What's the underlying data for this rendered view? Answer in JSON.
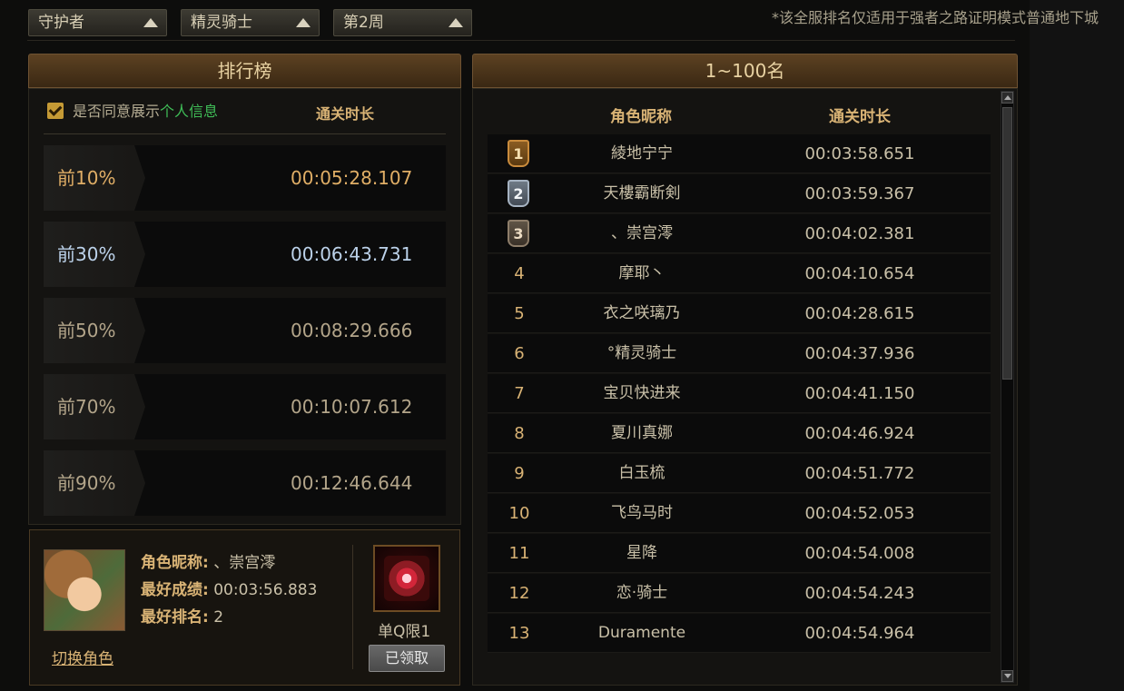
{
  "filters": [
    {
      "label": "守护者"
    },
    {
      "label": "精灵骑士"
    },
    {
      "label": "第2周"
    }
  ],
  "notice": "*该全服排名仅适用于强者之路证明模式普通地下城",
  "left_panel": {
    "title": "排行榜",
    "agree_prefix": "是否同意展示",
    "agree_link": "个人信息",
    "column_header": "通关时长",
    "tiers": [
      {
        "label": "前10%",
        "time": "00:05:28.107",
        "color": "#e0ae66"
      },
      {
        "label": "前30%",
        "time": "00:06:43.731",
        "color": "#bcd2ea"
      },
      {
        "label": "前50%",
        "time": "00:08:29.666",
        "color": "#b3a58a"
      },
      {
        "label": "前70%",
        "time": "00:10:07.612",
        "color": "#b3a58a"
      },
      {
        "label": "前90%",
        "time": "00:12:46.644",
        "color": "#b3a58a"
      }
    ]
  },
  "profile": {
    "name_key": "角色昵称:",
    "name_value": "、崇宫澪",
    "best_score_key": "最好成绩:",
    "best_score_value": "00:03:56.883",
    "best_rank_key": "最好排名:",
    "best_rank_value": "2",
    "switch_label": "切换角色",
    "reward_label": "单Q限1",
    "claimed_label": "已领取"
  },
  "right_panel": {
    "title": "1~100名",
    "headers": {
      "name": "角色昵称",
      "time": "通关时长"
    },
    "rows": [
      {
        "rank": "1",
        "name": "綾地宁宁",
        "time": "00:03:58.651"
      },
      {
        "rank": "2",
        "name": "天樓霸断剣",
        "time": "00:03:59.367"
      },
      {
        "rank": "3",
        "name": "、崇宫澪",
        "time": "00:04:02.381"
      },
      {
        "rank": "4",
        "name": "摩耶丶",
        "time": "00:04:10.654"
      },
      {
        "rank": "5",
        "name": "衣之咲璃乃",
        "time": "00:04:28.615"
      },
      {
        "rank": "6",
        "name": "°精灵骑士",
        "time": "00:04:37.936"
      },
      {
        "rank": "7",
        "name": "宝贝快进来",
        "time": "00:04:41.150"
      },
      {
        "rank": "8",
        "name": "夏川真娜",
        "time": "00:04:46.924"
      },
      {
        "rank": "9",
        "name": "白玉梳",
        "time": "00:04:51.772"
      },
      {
        "rank": "10",
        "name": "飞鸟马时",
        "time": "00:04:52.053"
      },
      {
        "rank": "11",
        "name": "星降",
        "time": "00:04:54.008"
      },
      {
        "rank": "12",
        "name": "恋·骑士",
        "time": "00:04:54.243"
      },
      {
        "rank": "13",
        "name": "Duramente",
        "time": "00:04:54.964"
      }
    ]
  }
}
